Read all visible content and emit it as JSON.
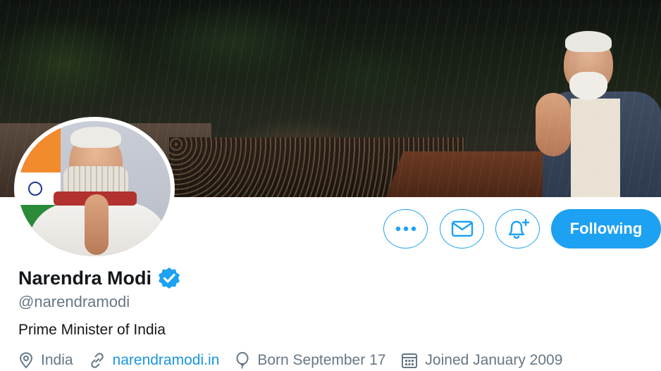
{
  "profile": {
    "name": "Narendra Modi",
    "handle": "@narendramodi",
    "bio": "Prime Minister of India",
    "verified": true
  },
  "actions": {
    "more_icon": "more-dots-icon",
    "message_icon": "envelope-icon",
    "notify_icon": "bell-plus-icon",
    "follow_label": "Following"
  },
  "meta": {
    "location": "India",
    "website": "narendramodi.in",
    "birthday": "Born September 17",
    "joined": "Joined January 2009"
  },
  "colors": {
    "accent": "#1da1f2",
    "link": "#1b95e0",
    "muted": "#657786",
    "text": "#14171a"
  }
}
